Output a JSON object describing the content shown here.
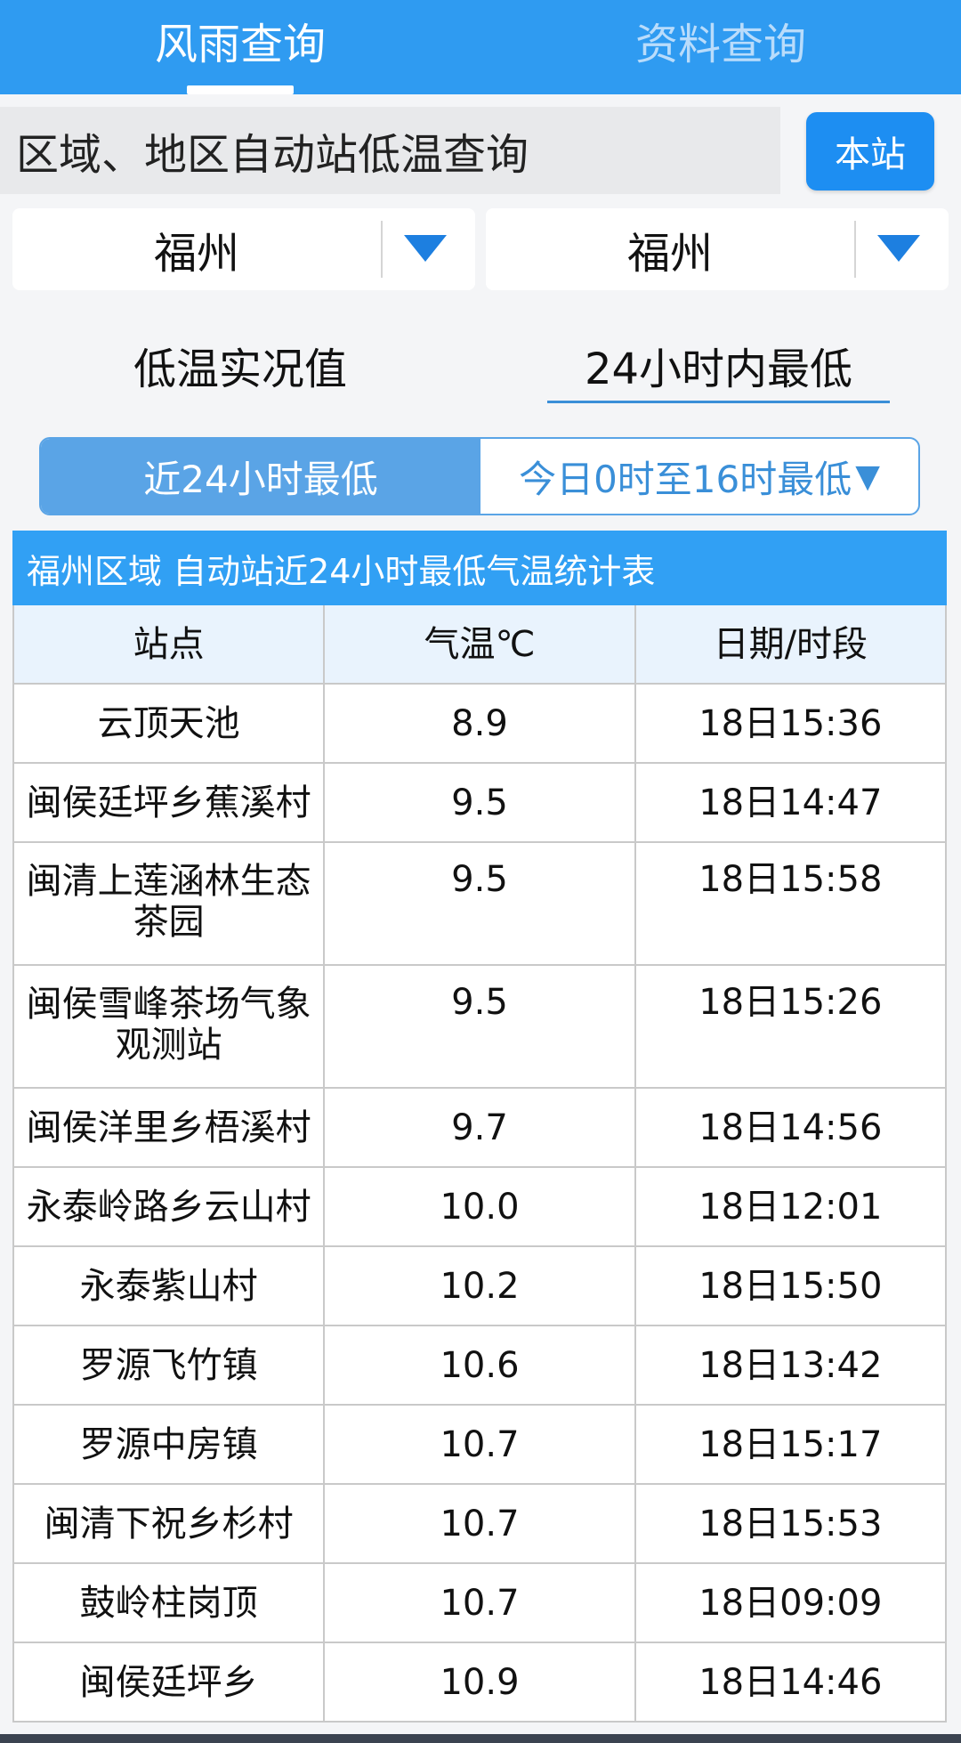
{
  "top_tabs": [
    {
      "label": "风雨查询",
      "active": true
    },
    {
      "label": "资料查询",
      "active": false
    }
  ],
  "query": {
    "title": "区域、地区自动站低温查询",
    "station_button": "本站"
  },
  "dropdowns": [
    {
      "value": "福州"
    },
    {
      "value": "福州"
    }
  ],
  "mode": {
    "left": "低温实况值",
    "right": "24小时内最低"
  },
  "segment": {
    "left": "近24小时最低",
    "right": "今日0时至16时最低",
    "right_arrow": "▼"
  },
  "table": {
    "title": "福州区域 自动站近24小时最低气温统计表",
    "headers": [
      "站点",
      "气温℃",
      "日期/时段"
    ],
    "rows": [
      {
        "station": "云顶天池",
        "temp": "8.9",
        "time": "18日15:36"
      },
      {
        "station": "闽侯廷坪乡蕉溪村",
        "temp": "9.5",
        "time": "18日14:47"
      },
      {
        "station": "闽清上莲涵林生态茶园",
        "temp": "9.5",
        "time": "18日15:58"
      },
      {
        "station": "闽侯雪峰茶场气象观测站",
        "temp": "9.5",
        "time": "18日15:26"
      },
      {
        "station": "闽侯洋里乡梧溪村",
        "temp": "9.7",
        "time": "18日14:56"
      },
      {
        "station": "永泰岭路乡云山村",
        "temp": "10.0",
        "time": "18日12:01"
      },
      {
        "station": "永泰紫山村",
        "temp": "10.2",
        "time": "18日15:50"
      },
      {
        "station": "罗源飞竹镇",
        "temp": "10.6",
        "time": "18日13:42"
      },
      {
        "station": "罗源中房镇",
        "temp": "10.7",
        "time": "18日15:17"
      },
      {
        "station": "闽清下祝乡杉村",
        "temp": "10.7",
        "time": "18日15:53"
      },
      {
        "station": "鼓岭柱岗顶",
        "temp": "10.7",
        "time": "18日09:09"
      },
      {
        "station": "闽侯廷坪乡",
        "temp": "10.9",
        "time": "18日14:46"
      }
    ]
  },
  "colors": {
    "primary": "#2f9bf1",
    "button": "#1d8ef2",
    "segment": "#5aa4e6",
    "header_bg": "#e9f3fd"
  }
}
